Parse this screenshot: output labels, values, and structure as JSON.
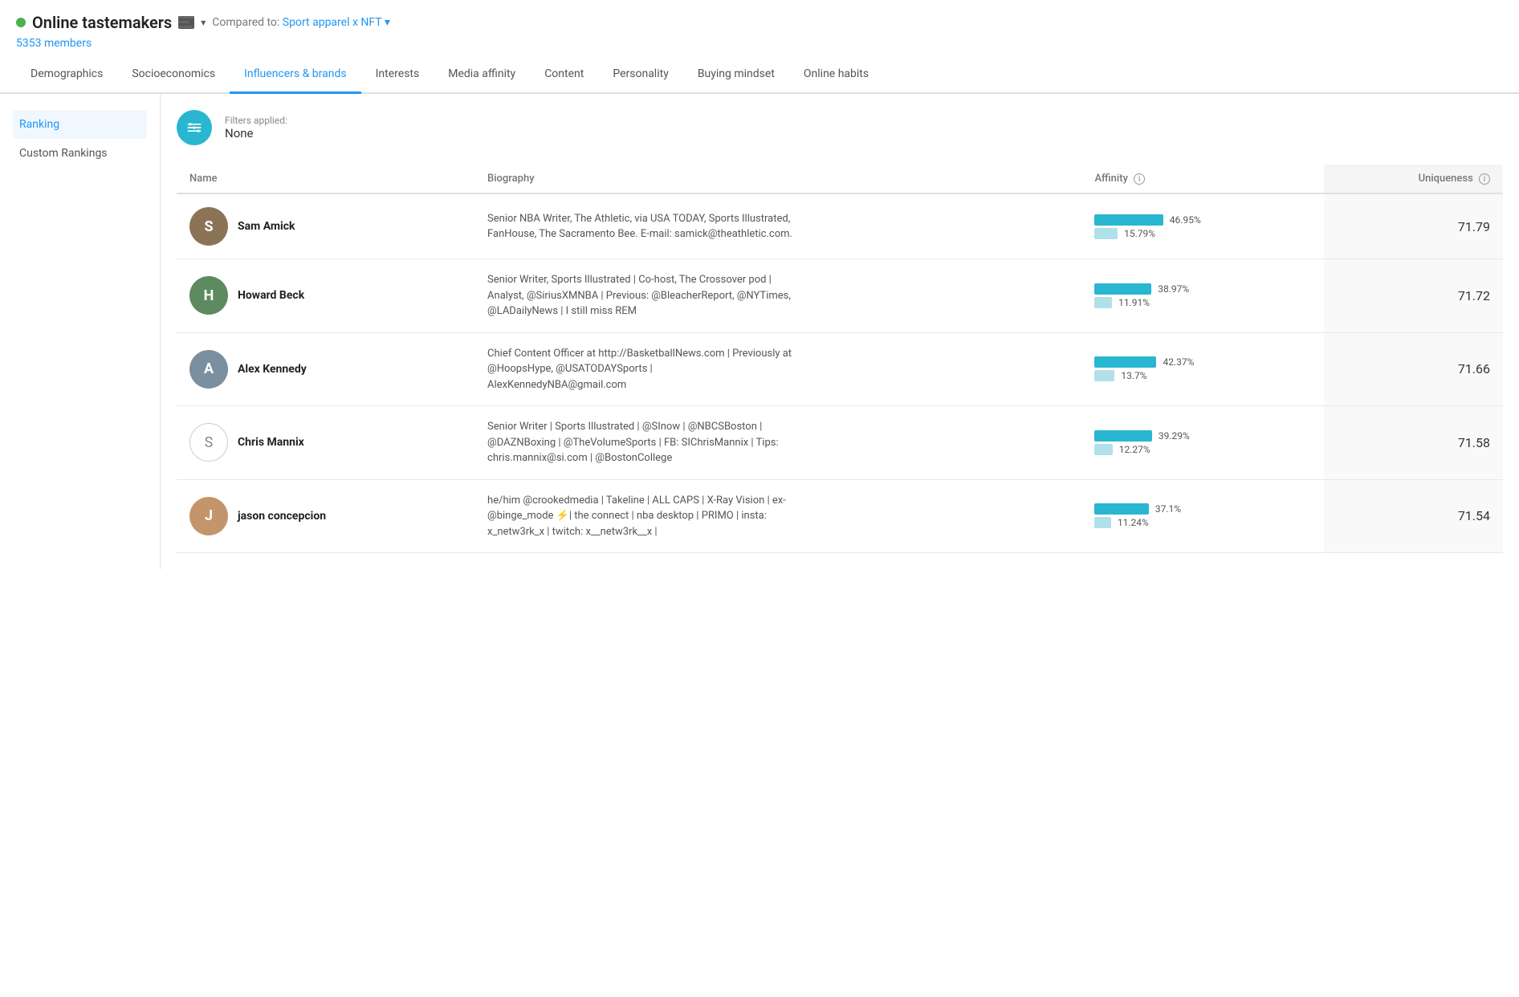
{
  "header": {
    "dot_color": "#4CAF50",
    "title": "Online tastemakers",
    "compared_label": "Compared to:",
    "compared_value": "Sport apparel x NFT",
    "members": "5353 members"
  },
  "nav": {
    "tabs": [
      {
        "id": "demographics",
        "label": "Demographics",
        "active": false
      },
      {
        "id": "socioeconomics",
        "label": "Socioeconomics",
        "active": false
      },
      {
        "id": "influencers",
        "label": "Influencers & brands",
        "active": true
      },
      {
        "id": "interests",
        "label": "Interests",
        "active": false
      },
      {
        "id": "media",
        "label": "Media affinity",
        "active": false
      },
      {
        "id": "content",
        "label": "Content",
        "active": false
      },
      {
        "id": "personality",
        "label": "Personality",
        "active": false
      },
      {
        "id": "buying",
        "label": "Buying mindset",
        "active": false
      },
      {
        "id": "online",
        "label": "Online habits",
        "active": false
      }
    ]
  },
  "sidebar": {
    "items": [
      {
        "id": "ranking",
        "label": "Ranking",
        "active": true
      },
      {
        "id": "custom",
        "label": "Custom Rankings",
        "active": false
      }
    ]
  },
  "filters": {
    "label": "Filters applied:",
    "value": "None"
  },
  "table": {
    "columns": {
      "name": "Name",
      "biography": "Biography",
      "affinity": "Affinity",
      "uniqueness": "Uniqueness"
    },
    "rows": [
      {
        "id": "sam-amick",
        "name": "Sam Amick",
        "avatar_type": "image",
        "avatar_bg": "#8B7355",
        "avatar_letter": "S",
        "biography": "Senior NBA Writer, The Athletic, via USA TODAY, Sports Illustrated, FanHouse, The Sacramento Bee. E-mail: samick@theathletic.com.",
        "affinity_primary": 46.95,
        "affinity_primary_label": "46.95%",
        "affinity_compare": 15.79,
        "affinity_compare_label": "15.79%",
        "uniqueness": "71.79"
      },
      {
        "id": "howard-beck",
        "name": "Howard Beck",
        "avatar_type": "image",
        "avatar_bg": "#5D8A5E",
        "avatar_letter": "H",
        "biography": "Senior Writer, Sports Illustrated | Co-host, The Crossover pod | Analyst, @SiriusXMNBA | Previous: @BleacherReport, @NYTimes, @LADailyNews | I still miss REM",
        "affinity_primary": 38.97,
        "affinity_primary_label": "38.97%",
        "affinity_compare": 11.91,
        "affinity_compare_label": "11.91%",
        "uniqueness": "71.72"
      },
      {
        "id": "alex-kennedy",
        "name": "Alex Kennedy",
        "avatar_type": "image",
        "avatar_bg": "#7B8FA0",
        "avatar_letter": "A",
        "biography": "Chief Content Officer at http://BasketballNews.com | Previously at @HoopsHype, @USATODAYSports | AlexKennedyNBA@gmail.com",
        "affinity_primary": 42.37,
        "affinity_primary_label": "42.37%",
        "affinity_compare": 13.7,
        "affinity_compare_label": "13.7%",
        "uniqueness": "71.66"
      },
      {
        "id": "chris-mannix",
        "name": "Chris Mannix",
        "avatar_type": "placeholder",
        "avatar_bg": "#fff",
        "avatar_letter": "S",
        "biography": "Senior Writer | Sports Illustrated | @SInow | @NBCSBoston | @DAZNBoxing | @TheVolumeSports | FB: SIChrisMannix | Tips: chris.mannix@si.com | @BostonCollege",
        "affinity_primary": 39.29,
        "affinity_primary_label": "39.29%",
        "affinity_compare": 12.27,
        "affinity_compare_label": "12.27%",
        "uniqueness": "71.58"
      },
      {
        "id": "jason-concepcion",
        "name": "jason concepcion",
        "avatar_type": "image",
        "avatar_bg": "#C4956A",
        "avatar_letter": "J",
        "biography": "he/him @crookedmedia | Takeline | ALL CAPS | X-Ray Vision | ex- @binge_mode ⚡| the connect | nba desktop | PRIMO | insta: x_netw3rk_x | twitch: x__netw3rk__x |",
        "affinity_primary": 37.1,
        "affinity_primary_label": "37.1%",
        "affinity_compare": 11.24,
        "affinity_compare_label": "11.24%",
        "uniqueness": "71.54"
      }
    ]
  },
  "icons": {
    "filter": "filter-icon",
    "dropdown": "chevron-down-icon",
    "info": "info-icon"
  }
}
